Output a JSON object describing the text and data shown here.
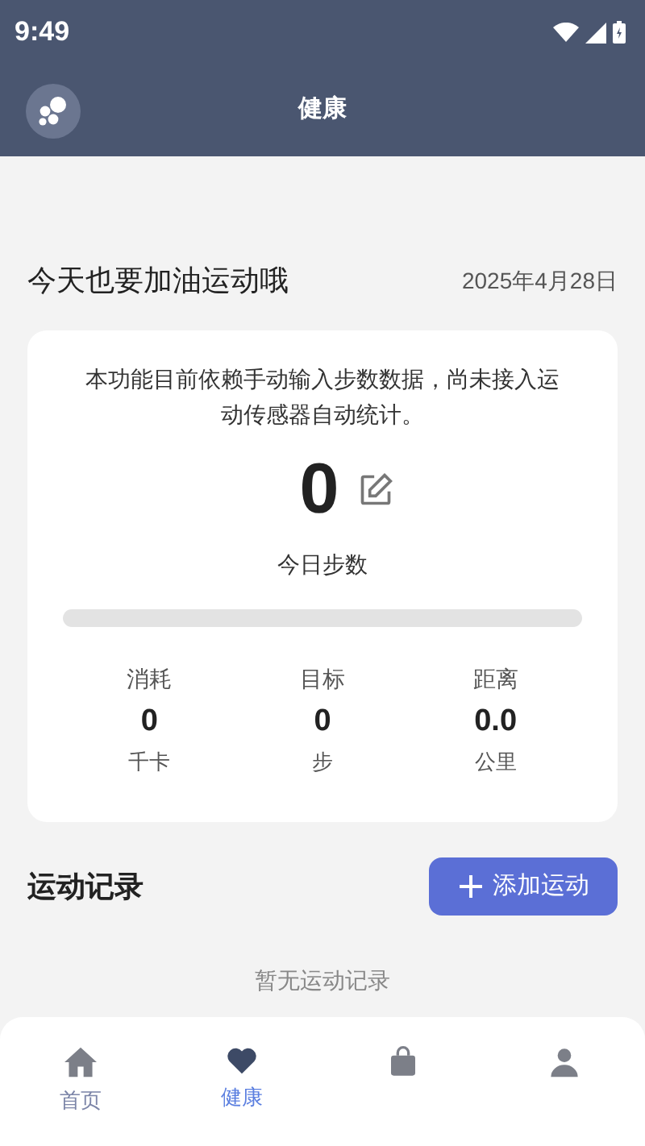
{
  "status_bar": {
    "time": "9:49"
  },
  "header": {
    "title": "健康"
  },
  "greeting": {
    "text": "今天也要加油运动哦",
    "date": "2025年4月28日"
  },
  "steps_card": {
    "notice": "本功能目前依赖手动输入步数数据，尚未接入运动传感器自动统计。",
    "steps": "0",
    "steps_label": "今日步数",
    "level": 0,
    "stats": [
      {
        "label": "消耗",
        "value": "0",
        "unit": "千卡"
      },
      {
        "label": "目标",
        "value": "0",
        "unit": "步"
      },
      {
        "label": "距离",
        "value": "0.0",
        "unit": "公里"
      }
    ]
  },
  "records": {
    "title": "运动记录",
    "add_button": "添加运动",
    "empty": "暂无运动记录"
  },
  "bottom_nav": [
    {
      "kind": "home",
      "label": "首页",
      "selected": false
    },
    {
      "kind": "heart",
      "label": "健康",
      "selected": true
    },
    {
      "kind": "bag",
      "selected": false
    },
    {
      "kind": "person",
      "selected": false
    }
  ]
}
